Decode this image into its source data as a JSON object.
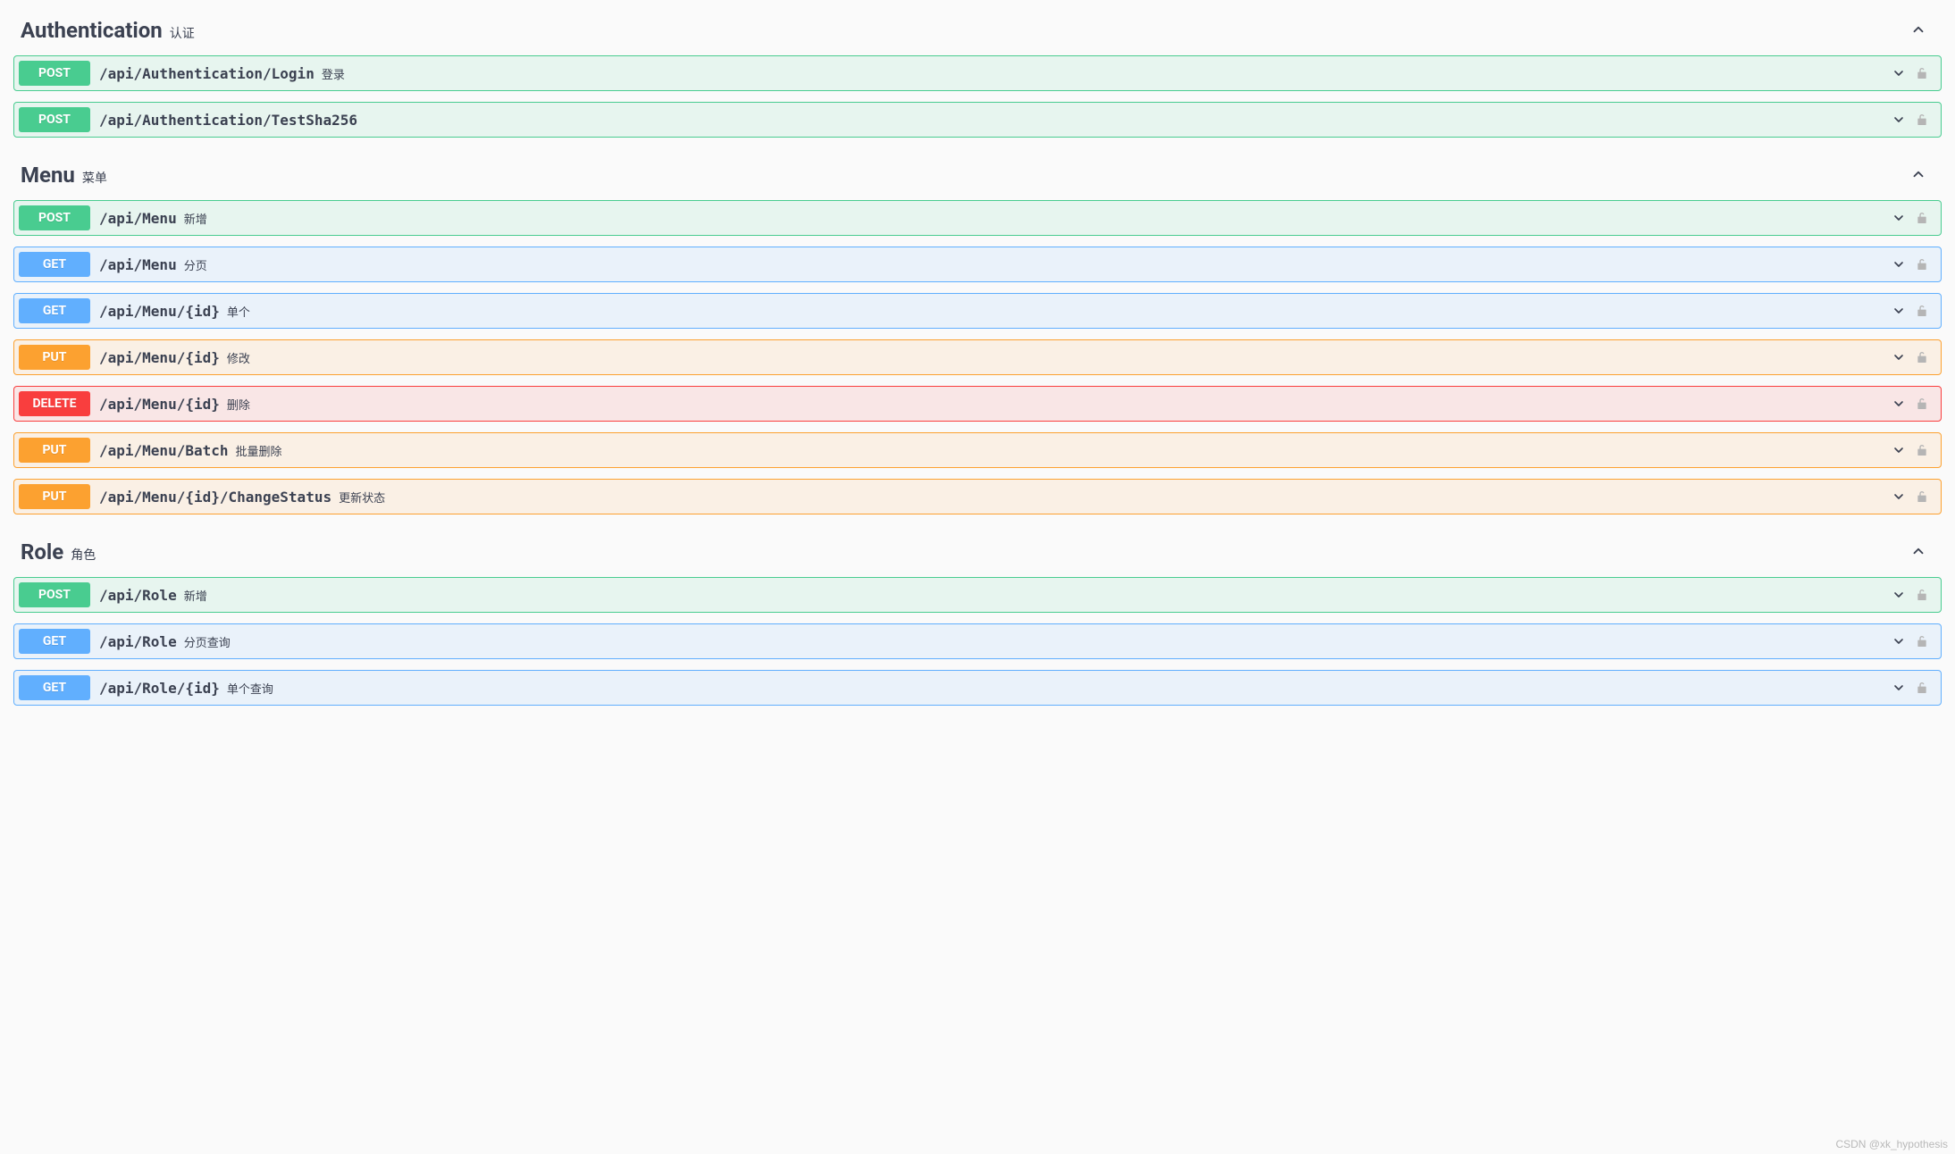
{
  "watermark": "CSDN @xk_hypothesis",
  "sections": [
    {
      "name": "Authentication",
      "desc": "认证",
      "ops": [
        {
          "method": "POST",
          "path": "/api/Authentication/Login",
          "desc": "登录"
        },
        {
          "method": "POST",
          "path": "/api/Authentication/TestSha256",
          "desc": ""
        }
      ]
    },
    {
      "name": "Menu",
      "desc": "菜单",
      "ops": [
        {
          "method": "POST",
          "path": "/api/Menu",
          "desc": "新增"
        },
        {
          "method": "GET",
          "path": "/api/Menu",
          "desc": "分页"
        },
        {
          "method": "GET",
          "path": "/api/Menu/{id}",
          "desc": "单个"
        },
        {
          "method": "PUT",
          "path": "/api/Menu/{id}",
          "desc": "修改"
        },
        {
          "method": "DELETE",
          "path": "/api/Menu/{id}",
          "desc": "删除"
        },
        {
          "method": "PUT",
          "path": "/api/Menu/Batch",
          "desc": "批量删除"
        },
        {
          "method": "PUT",
          "path": "/api/Menu/{id}/ChangeStatus",
          "desc": "更新状态"
        }
      ]
    },
    {
      "name": "Role",
      "desc": "角色",
      "ops": [
        {
          "method": "POST",
          "path": "/api/Role",
          "desc": "新增"
        },
        {
          "method": "GET",
          "path": "/api/Role",
          "desc": "分页查询"
        },
        {
          "method": "GET",
          "path": "/api/Role/{id}",
          "desc": "单个查询"
        }
      ]
    }
  ]
}
